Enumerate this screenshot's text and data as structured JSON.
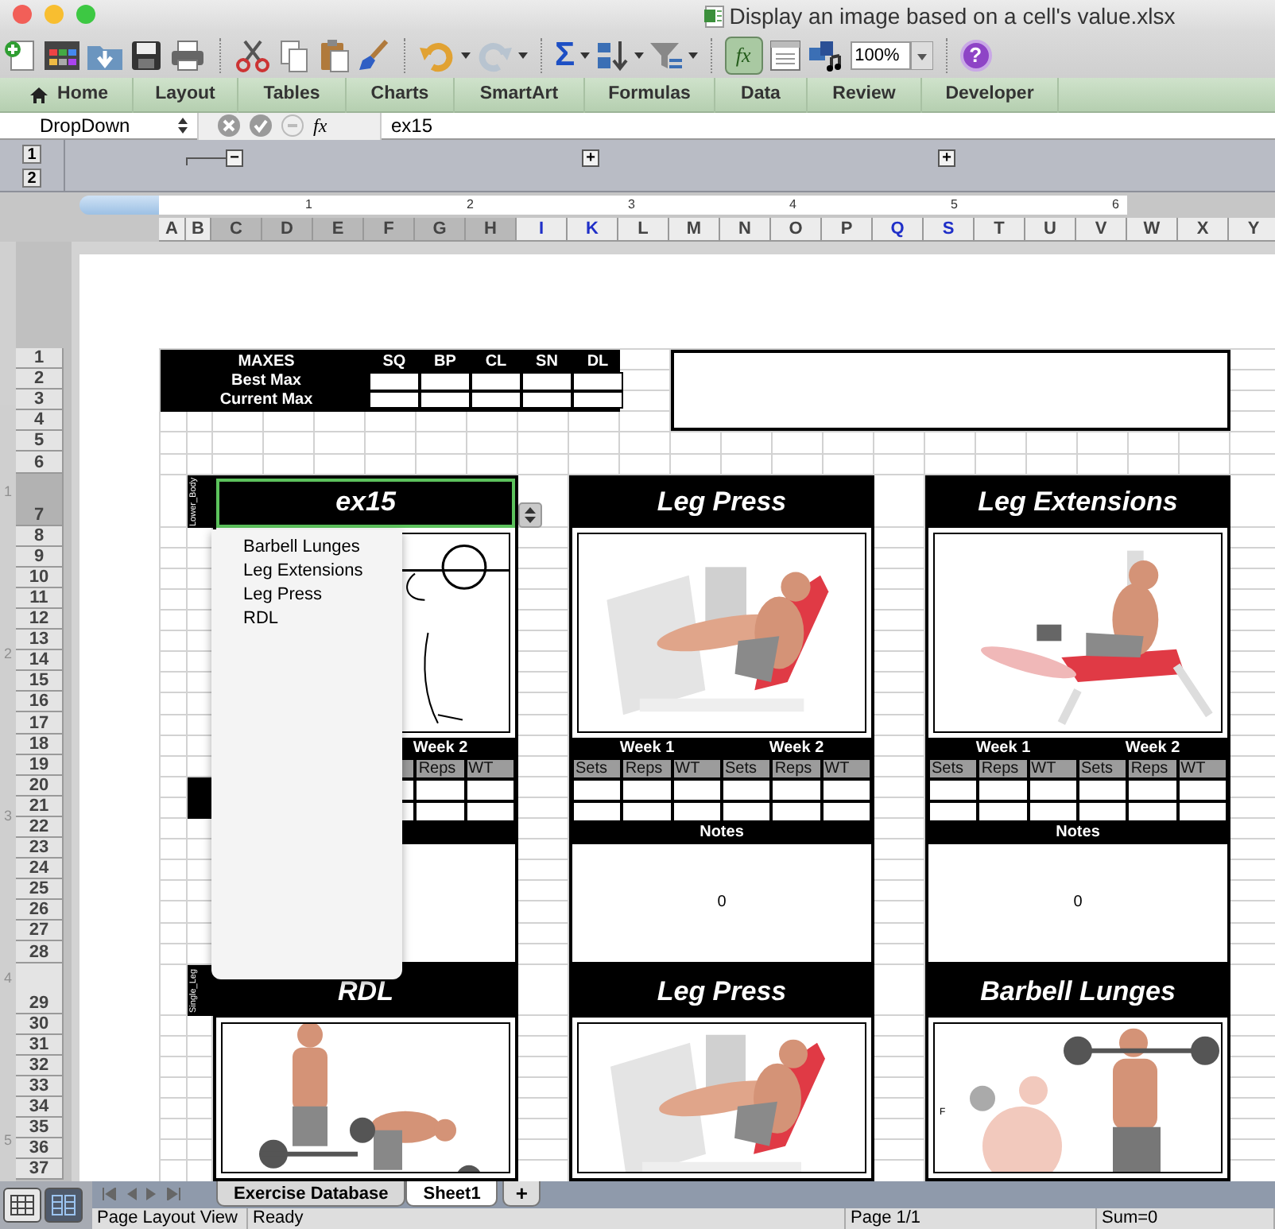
{
  "window": {
    "title": "Display an image based on a cell's value.xlsx"
  },
  "toolbar": {
    "autosum": "Σ",
    "formula_builder": {
      "label": "fx",
      "pressed": true
    },
    "redo": {
      "disabled": true
    },
    "zoom": "100%",
    "help": "?"
  },
  "ribbon_tabs": [
    "Home",
    "Layout",
    "Tables",
    "Charts",
    "SmartArt",
    "Formulas",
    "Data",
    "Review",
    "Developer"
  ],
  "formula_bar": {
    "name_box": "DropDown",
    "fx": "fx",
    "value": "ex15"
  },
  "outline": {
    "levels": [
      "1",
      "2"
    ],
    "buttons": [
      {
        "symbol": "−"
      },
      {
        "symbol": "+"
      },
      {
        "symbol": "+"
      }
    ]
  },
  "ruler": {
    "horizontal": [
      "1",
      "2",
      "3",
      "4",
      "5",
      "6"
    ],
    "vertical": [
      "1",
      "2",
      "3",
      "4",
      "5"
    ]
  },
  "columns": [
    {
      "label": "A",
      "selected": false,
      "hidden_adjacent": false
    },
    {
      "label": "B",
      "selected": false,
      "hidden_adjacent": false
    },
    {
      "label": "C",
      "selected": true,
      "hidden_adjacent": false
    },
    {
      "label": "D",
      "selected": true,
      "hidden_adjacent": false
    },
    {
      "label": "E",
      "selected": true,
      "hidden_adjacent": false
    },
    {
      "label": "F",
      "selected": true,
      "hidden_adjacent": false
    },
    {
      "label": "G",
      "selected": true,
      "hidden_adjacent": false
    },
    {
      "label": "H",
      "selected": true,
      "hidden_adjacent": false
    },
    {
      "label": "I",
      "selected": false,
      "hidden_adjacent": true
    },
    {
      "label": "K",
      "selected": false,
      "hidden_adjacent": true
    },
    {
      "label": "L",
      "selected": false,
      "hidden_adjacent": false
    },
    {
      "label": "M",
      "selected": false,
      "hidden_adjacent": false
    },
    {
      "label": "N",
      "selected": false,
      "hidden_adjacent": false
    },
    {
      "label": "O",
      "selected": false,
      "hidden_adjacent": false
    },
    {
      "label": "P",
      "selected": false,
      "hidden_adjacent": false
    },
    {
      "label": "Q",
      "selected": false,
      "hidden_adjacent": true
    },
    {
      "label": "S",
      "selected": false,
      "hidden_adjacent": true
    },
    {
      "label": "T",
      "selected": false,
      "hidden_adjacent": false
    },
    {
      "label": "U",
      "selected": false,
      "hidden_adjacent": false
    },
    {
      "label": "V",
      "selected": false,
      "hidden_adjacent": false
    },
    {
      "label": "W",
      "selected": false,
      "hidden_adjacent": false
    },
    {
      "label": "X",
      "selected": false,
      "hidden_adjacent": false
    },
    {
      "label": "Y",
      "selected": false,
      "hidden_adjacent": false
    }
  ],
  "rows": [
    {
      "label": "1",
      "selected": false
    },
    {
      "label": "2",
      "selected": false
    },
    {
      "label": "3",
      "selected": false
    },
    {
      "label": "4",
      "selected": false
    },
    {
      "label": "5",
      "selected": false
    },
    {
      "label": "6",
      "selected": false
    },
    {
      "label": "7",
      "selected": true
    },
    {
      "label": "8",
      "selected": false
    },
    {
      "label": "9",
      "selected": false
    },
    {
      "label": "10",
      "selected": false
    },
    {
      "label": "11",
      "selected": false
    },
    {
      "label": "12",
      "selected": false
    },
    {
      "label": "13",
      "selected": false
    },
    {
      "label": "14",
      "selected": false
    },
    {
      "label": "15",
      "selected": false
    },
    {
      "label": "16",
      "selected": false
    },
    {
      "label": "17",
      "selected": false
    },
    {
      "label": "18",
      "selected": false
    },
    {
      "label": "19",
      "selected": false
    },
    {
      "label": "20",
      "selected": false
    },
    {
      "label": "21",
      "selected": false
    },
    {
      "label": "22",
      "selected": false
    },
    {
      "label": "23",
      "selected": false
    },
    {
      "label": "24",
      "selected": false
    },
    {
      "label": "25",
      "selected": false
    },
    {
      "label": "26",
      "selected": false
    },
    {
      "label": "27",
      "selected": false
    },
    {
      "label": "28",
      "selected": false
    },
    {
      "label": "29",
      "selected": false
    },
    {
      "label": "30",
      "selected": false
    },
    {
      "label": "31",
      "selected": false
    },
    {
      "label": "32",
      "selected": false
    },
    {
      "label": "33",
      "selected": false
    },
    {
      "label": "34",
      "selected": false
    },
    {
      "label": "35",
      "selected": false
    },
    {
      "label": "36",
      "selected": false
    },
    {
      "label": "37",
      "selected": false
    }
  ],
  "maxes": {
    "title": "MAXES",
    "columns": [
      "SQ",
      "BP",
      "CL",
      "SN",
      "DL"
    ],
    "rows": [
      "Best Max",
      "Current Max"
    ]
  },
  "cards": [
    {
      "title": "ex15",
      "group_label": "Lower_Body",
      "selected": true,
      "weeks": [
        {
          "label": "Week 2",
          "columns": [
            "Reps",
            "WT"
          ]
        }
      ]
    },
    {
      "title": "Leg Press",
      "selected": false,
      "weeks": [
        {
          "label": "Week 1",
          "columns": [
            "Sets",
            "Reps",
            "WT"
          ]
        },
        {
          "label": "Week 2",
          "columns": [
            "Sets",
            "Reps",
            "WT"
          ]
        }
      ],
      "notes_label": "Notes",
      "notes_value": "0"
    },
    {
      "title": "Leg Extensions",
      "selected": false,
      "weeks": [
        {
          "label": "Week 1",
          "columns": [
            "Sets",
            "Reps",
            "WT"
          ]
        },
        {
          "label": "Week 2",
          "columns": [
            "Sets",
            "Reps",
            "WT"
          ]
        }
      ],
      "notes_label": "Notes",
      "notes_value": "0"
    },
    {
      "title": "RDL",
      "group_label": "Single_Leg",
      "selected": false
    },
    {
      "title": "Leg Press",
      "selected": false
    },
    {
      "title": "Barbell Lunges",
      "selected": false,
      "picture_mark": "F"
    }
  ],
  "dropdown": {
    "items": [
      {
        "label": "Barbell Lunges",
        "selected": false
      },
      {
        "label": "Leg Extensions",
        "selected": false
      },
      {
        "label": "Leg Press",
        "selected": false
      },
      {
        "label": "RDL",
        "selected": false
      }
    ]
  },
  "sheet_tabs": [
    {
      "label": "Exercise Database",
      "selected": false
    },
    {
      "label": "Sheet1",
      "selected": true
    }
  ],
  "add_sheet": "+",
  "views": [
    {
      "selected": false
    },
    {
      "selected": true
    }
  ],
  "status_bar": [
    "Page Layout View",
    "Ready",
    "Page 1/1",
    "Sum=0"
  ]
}
